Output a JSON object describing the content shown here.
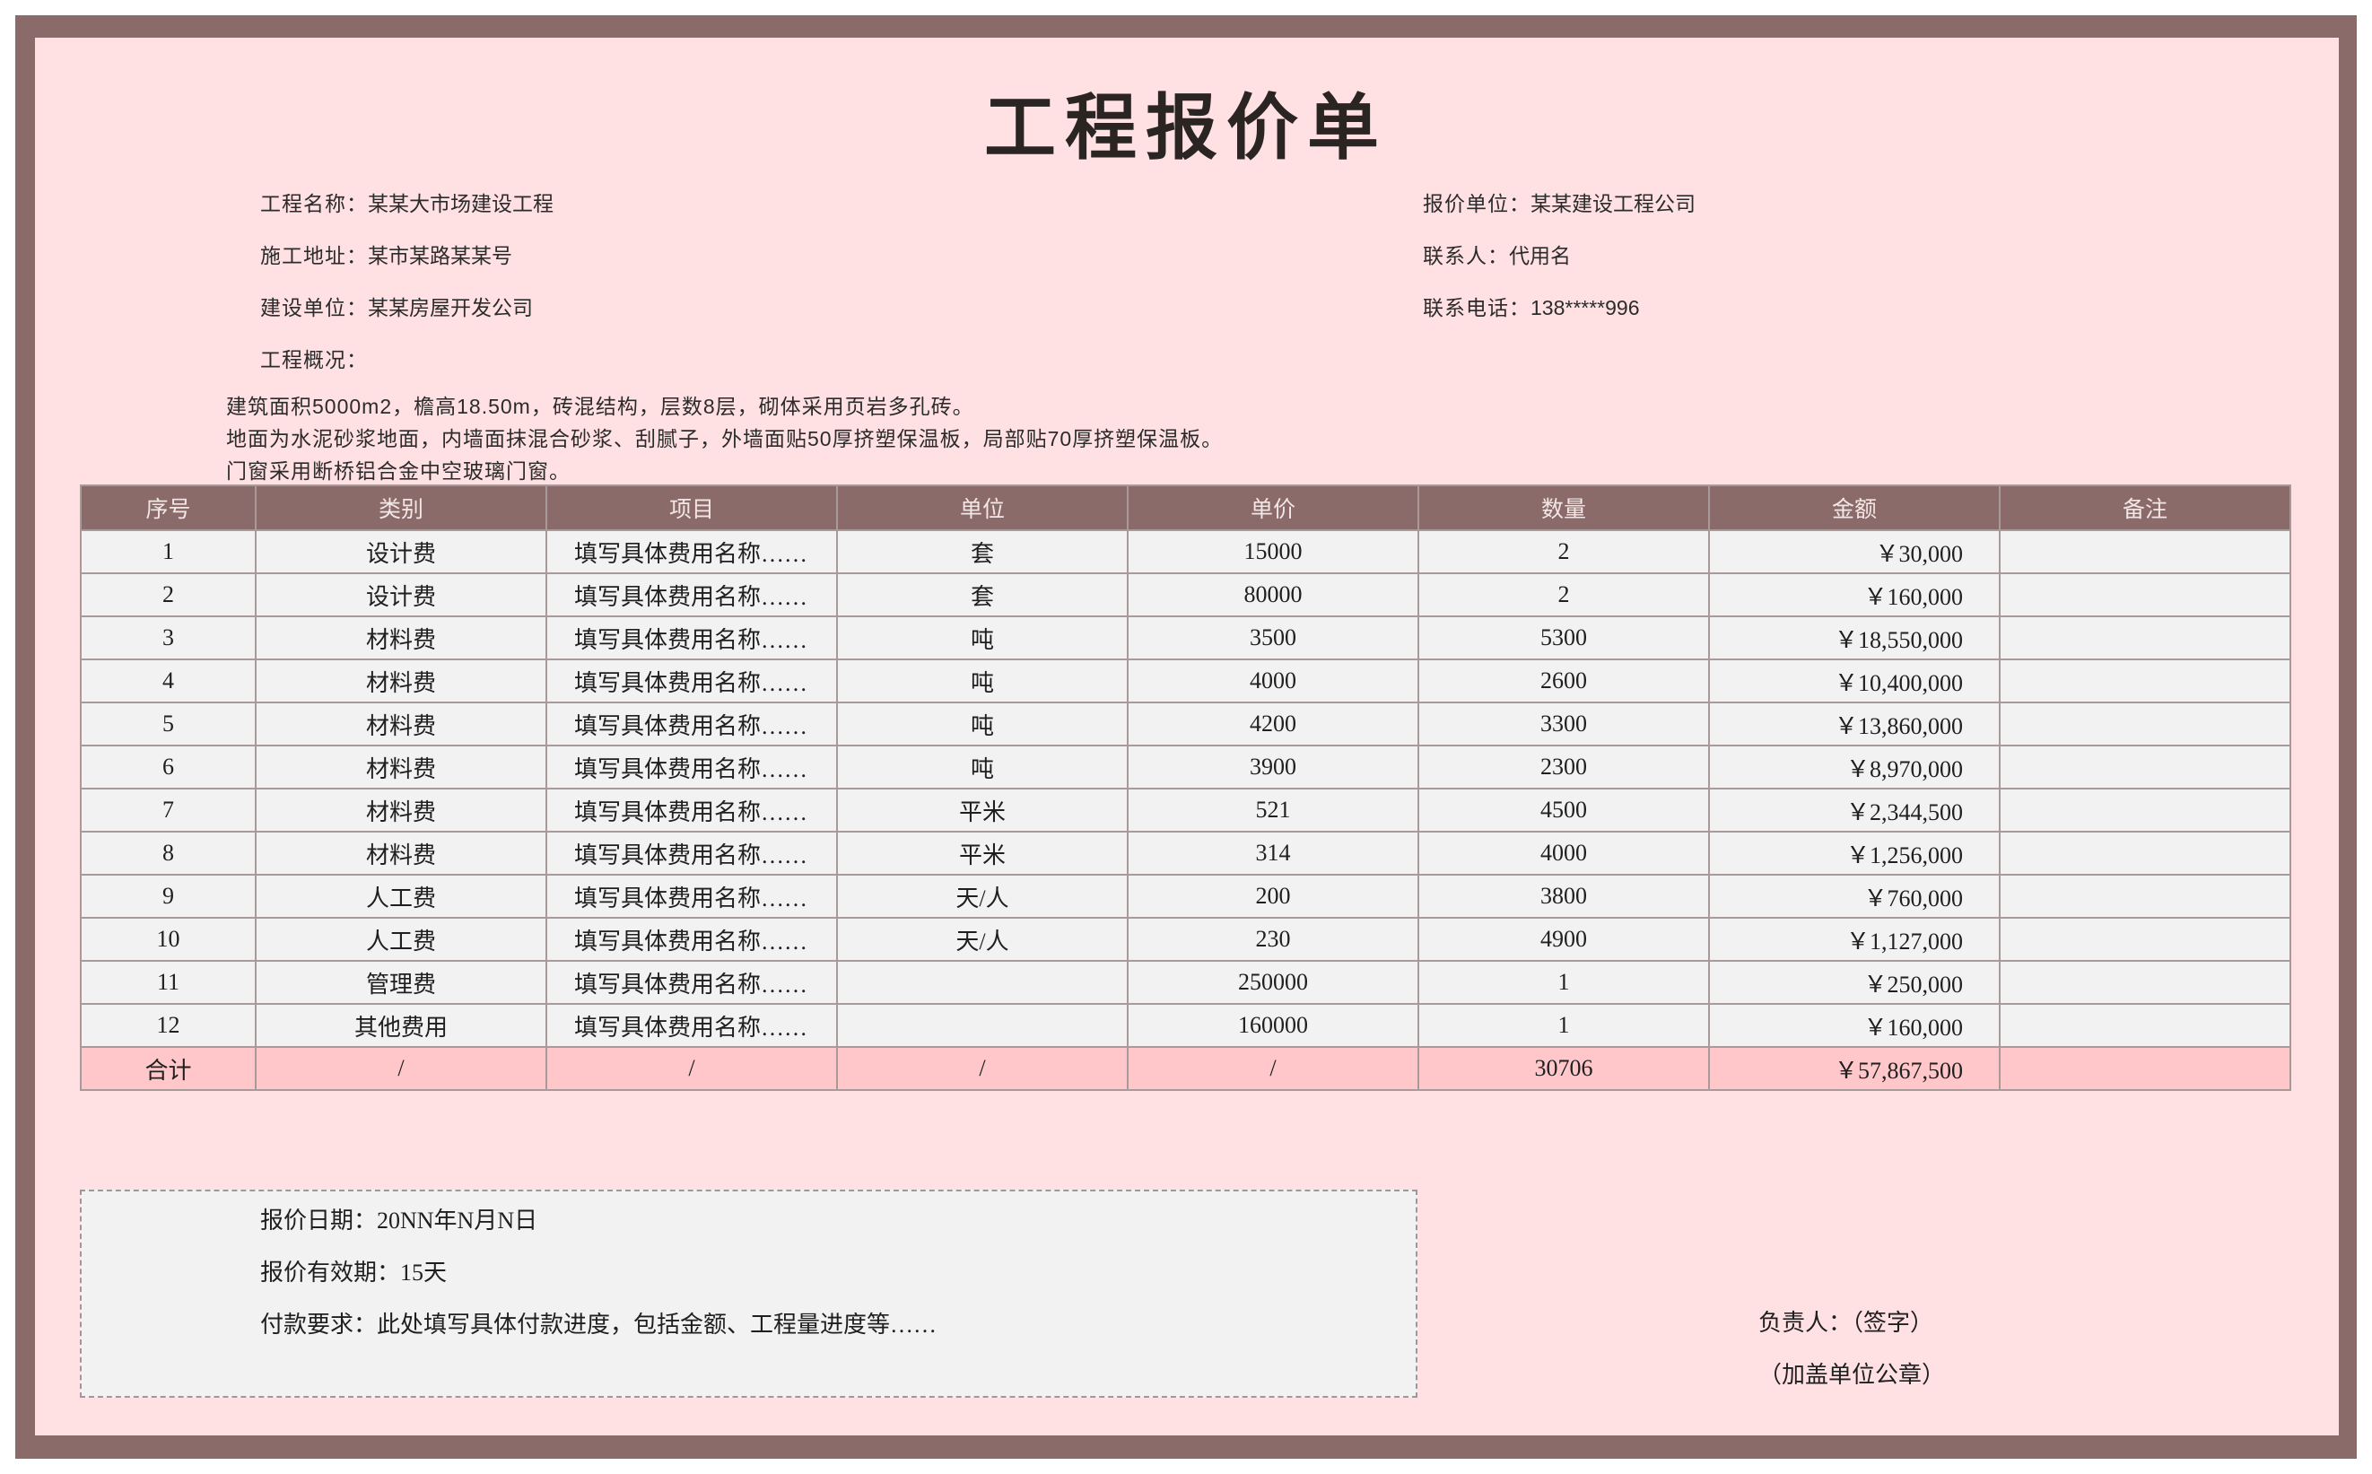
{
  "title": "工程报价单",
  "info": {
    "project_name_label": "工程名称：",
    "project_name": "某某大市场建设工程",
    "address_label": "施工地址：",
    "address": "某市某路某某号",
    "builder_label": "建设单位：",
    "builder": "某某房屋开发公司",
    "overview_label": "工程概况：",
    "quote_unit_label": "报价单位：",
    "quote_unit": "某某建设工程公司",
    "contact_label": "联系人：",
    "contact": "代用名",
    "phone_label": "联系电话：",
    "phone": "138*****996"
  },
  "summary": [
    "建筑面积5000m2，檐高18.50m，砖混结构，层数8层，砌体采用页岩多孔砖。",
    "地面为水泥砂浆地面，内墙面抹混合砂浆、刮腻子，外墙面贴50厚挤塑保温板，局部贴70厚挤塑保温板。",
    "门窗采用断桥铝合金中空玻璃门窗。"
  ],
  "table": {
    "headers": [
      "序号",
      "类别",
      "项目",
      "单位",
      "单价",
      "数量",
      "金额",
      "备注"
    ],
    "rows": [
      [
        "1",
        "设计费",
        "填写具体费用名称……",
        "套",
        "15000",
        "2",
        "￥30,000",
        ""
      ],
      [
        "2",
        "设计费",
        "填写具体费用名称……",
        "套",
        "80000",
        "2",
        "￥160,000",
        ""
      ],
      [
        "3",
        "材料费",
        "填写具体费用名称……",
        "吨",
        "3500",
        "5300",
        "￥18,550,000",
        ""
      ],
      [
        "4",
        "材料费",
        "填写具体费用名称……",
        "吨",
        "4000",
        "2600",
        "￥10,400,000",
        ""
      ],
      [
        "5",
        "材料费",
        "填写具体费用名称……",
        "吨",
        "4200",
        "3300",
        "￥13,860,000",
        ""
      ],
      [
        "6",
        "材料费",
        "填写具体费用名称……",
        "吨",
        "3900",
        "2300",
        "￥8,970,000",
        ""
      ],
      [
        "7",
        "材料费",
        "填写具体费用名称……",
        "平米",
        "521",
        "4500",
        "￥2,344,500",
        ""
      ],
      [
        "8",
        "材料费",
        "填写具体费用名称……",
        "平米",
        "314",
        "4000",
        "￥1,256,000",
        ""
      ],
      [
        "9",
        "人工费",
        "填写具体费用名称……",
        "天/人",
        "200",
        "3800",
        "￥760,000",
        ""
      ],
      [
        "10",
        "人工费",
        "填写具体费用名称……",
        "天/人",
        "230",
        "4900",
        "￥1,127,000",
        ""
      ],
      [
        "11",
        "管理费",
        "填写具体费用名称……",
        "",
        "250000",
        "1",
        "￥250,000",
        ""
      ],
      [
        "12",
        "其他费用",
        "填写具体费用名称……",
        "",
        "160000",
        "1",
        "￥160,000",
        ""
      ]
    ],
    "total": [
      "合计",
      "/",
      "/",
      "/",
      "/",
      "30706",
      "￥57,867,500",
      ""
    ]
  },
  "notes": {
    "date": "报价日期：20NN年N月N日",
    "validity": "报价有效期：15天",
    "payment": "付款要求：此处填写具体付款进度，包括金额、工程量进度等……"
  },
  "signature": {
    "responsible": "负责人：（签字）",
    "seal": "（加盖单位公章）"
  }
}
